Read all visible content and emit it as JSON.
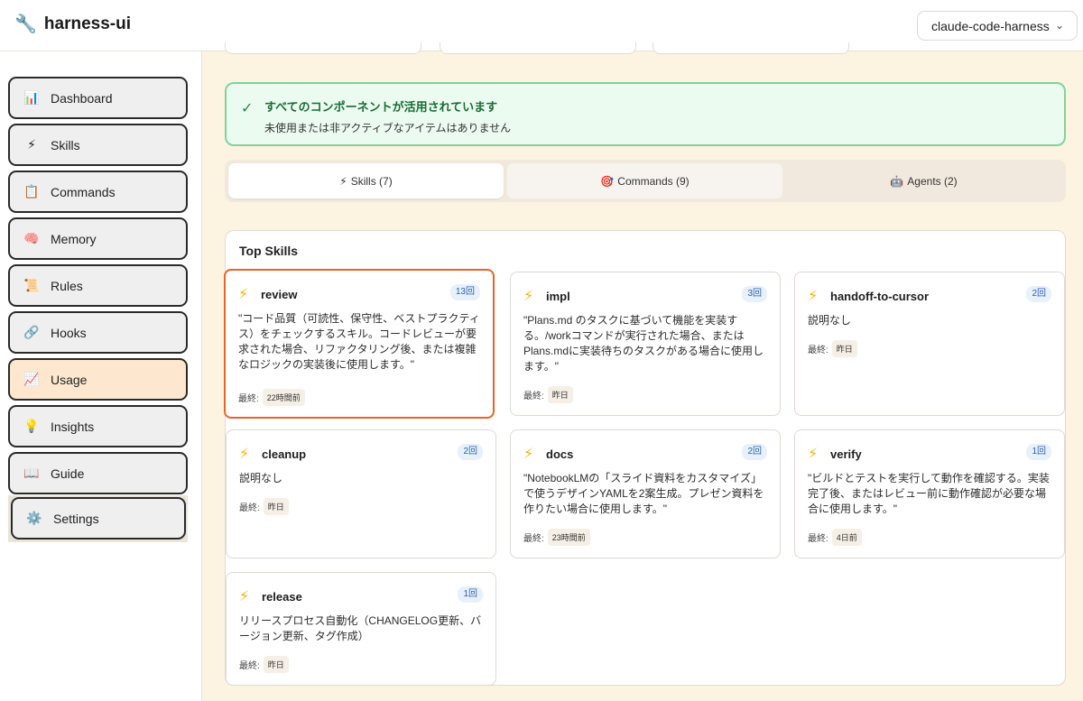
{
  "app": {
    "icon": "wrench-icon",
    "title": "harness-ui"
  },
  "project_select": {
    "value": "claude-code-harness",
    "icon": "chevron-down-icon"
  },
  "sidebar": {
    "items": [
      {
        "label": "Dashboard",
        "icon": "📊",
        "icon_name": "bar-chart-icon"
      },
      {
        "label": "Skills",
        "icon": "⚡",
        "icon_name": "lightning-icon"
      },
      {
        "label": "Commands",
        "icon": "📋",
        "icon_name": "clipboard-icon"
      },
      {
        "label": "Memory",
        "icon": "🧠",
        "icon_name": "brain-icon"
      },
      {
        "label": "Rules",
        "icon": "📜",
        "icon_name": "scroll-icon"
      },
      {
        "label": "Hooks",
        "icon": "🔗",
        "icon_name": "link-icon"
      },
      {
        "label": "Usage",
        "icon": "📈",
        "icon_name": "trend-chart-icon",
        "active": true
      },
      {
        "label": "Insights",
        "icon": "💡",
        "icon_name": "lightbulb-icon"
      },
      {
        "label": "Guide",
        "icon": "📖",
        "icon_name": "book-icon"
      },
      {
        "label": "Settings",
        "icon": "⚙️",
        "icon_name": "gear-icon"
      }
    ]
  },
  "alert": {
    "icon": "✓",
    "title": "すべてのコンポーネントが活用されています",
    "subtitle": "未使用または非アクティブなアイテムはありません"
  },
  "tabs": [
    {
      "icon": "⚡",
      "label": "Skills (7)",
      "selected": true
    },
    {
      "icon": "🎯",
      "label": "Commands (9)"
    },
    {
      "icon": "🤖",
      "label": "Agents (2)"
    }
  ],
  "panel": {
    "title": "Top Skills",
    "last_label": "最終:",
    "cards": [
      {
        "name": "review",
        "count": "13回",
        "desc": "\"コード品質（可読性、保守性、ベストプラクティス）をチェックするスキル。コードレビューが要求された場合、リファクタリング後、または複雑なロジックの実装後に使用します。\"",
        "last": "22時間前",
        "selected": true
      },
      {
        "name": "impl",
        "count": "3回",
        "desc": "\"Plans.md のタスクに基づいて機能を実装する。/workコマンドが実行された場合、またはPlans.mdに実装待ちのタスクがある場合に使用します。\"",
        "last": "昨日"
      },
      {
        "name": "handoff-to-cursor",
        "count": "2回",
        "desc": "説明なし",
        "last": "昨日"
      },
      {
        "name": "cleanup",
        "count": "2回",
        "desc": "説明なし",
        "last": "昨日"
      },
      {
        "name": "docs",
        "count": "2回",
        "desc": "\"NotebookLMの「スライド資料をカスタマイズ」で使うデザインYAMLを2案生成。プレゼン資料を作りたい場合に使用します。\"",
        "last": "23時間前"
      },
      {
        "name": "verify",
        "count": "1回",
        "desc": "\"ビルドとテストを実行して動作を確認する。実装完了後、またはレビュー前に動作確認が必要な場合に使用します。\"",
        "last": "4日前"
      },
      {
        "name": "release",
        "count": "1回",
        "desc": "リリースプロセス自動化（CHANGELOG更新、バージョン更新、タグ作成）",
        "last": "昨日"
      }
    ]
  }
}
